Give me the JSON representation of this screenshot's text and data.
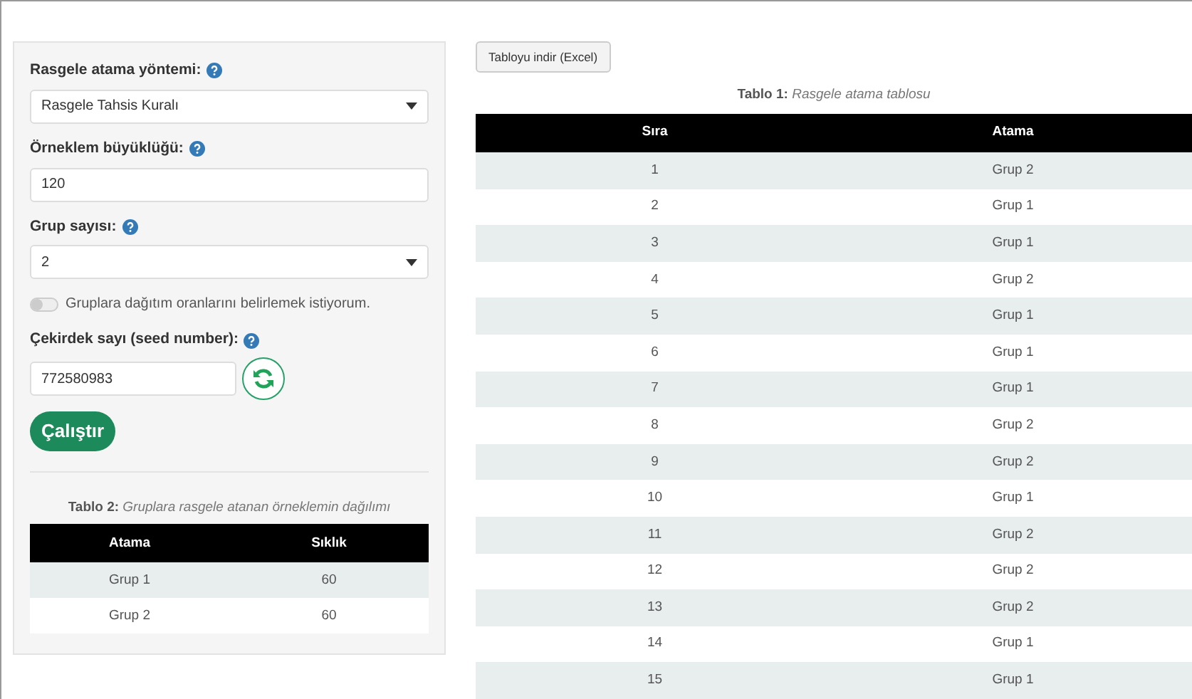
{
  "sidebar": {
    "fields": [
      {
        "kind": "select",
        "label": "Rasgele atama yöntemi:",
        "value": "Rasgele Tahsis Kuralı"
      },
      {
        "kind": "input",
        "label": "Örneklem büyüklüğü:",
        "value": "120"
      },
      {
        "kind": "select",
        "label": "Grup sayısı:",
        "value": "2"
      }
    ],
    "toggle": {
      "label": "Gruplara dağıtım oranlarını belirlemek istiyorum.",
      "on": false
    },
    "seed": {
      "label": "Çekirdek sayı (seed number):",
      "value": "772580983"
    },
    "run_button": "Çalıştır",
    "table": {
      "caption": "**Tablo 2:** *Gruplara rasgele atanan örneklemin dağılımı*",
      "columns": [
        "Atama",
        "Sıklık"
      ],
      "rows": [
        [
          "Grup 1",
          "60"
        ],
        [
          "Grup 2",
          "60"
        ]
      ]
    }
  },
  "main": {
    "download_button": "Tabloyu indir (Excel)",
    "table": {
      "caption": "**Tablo 1:** *Rasgele atama tablosu*",
      "columns": [
        "Sıra",
        "Atama"
      ],
      "rows": [
        [
          "1",
          "Grup 2"
        ],
        [
          "2",
          "Grup 1"
        ],
        [
          "3",
          "Grup 1"
        ],
        [
          "4",
          "Grup 2"
        ],
        [
          "5",
          "Grup 1"
        ],
        [
          "6",
          "Grup 1"
        ],
        [
          "7",
          "Grup 1"
        ],
        [
          "8",
          "Grup 2"
        ],
        [
          "9",
          "Grup 2"
        ],
        [
          "10",
          "Grup 1"
        ],
        [
          "11",
          "Grup 2"
        ],
        [
          "12",
          "Grup 2"
        ],
        [
          "13",
          "Grup 2"
        ],
        [
          "14",
          "Grup 1"
        ],
        [
          "15",
          "Grup 1"
        ]
      ]
    }
  }
}
